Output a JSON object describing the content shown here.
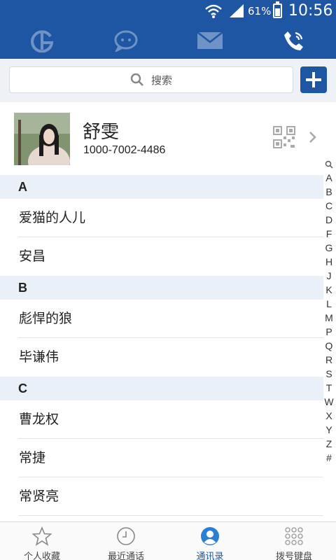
{
  "status_bar": {
    "battery_percent": "61%",
    "time": "10:56"
  },
  "top_tabs": [
    {
      "icon": "g-logo-icon",
      "active": false
    },
    {
      "icon": "chat-bubble-icon",
      "active": false
    },
    {
      "icon": "mail-icon",
      "active": false
    },
    {
      "icon": "phone-icon",
      "active": true
    }
  ],
  "search": {
    "placeholder": "搜索"
  },
  "profile": {
    "name": "舒雯",
    "number": "1000-7002-4486"
  },
  "sections": [
    {
      "letter": "A",
      "contacts": [
        "爱猫的人儿",
        "安昌"
      ]
    },
    {
      "letter": "B",
      "contacts": [
        "彪悍的狼",
        "毕谦伟"
      ]
    },
    {
      "letter": "C",
      "contacts": [
        "曹龙权",
        "常捷",
        "常贤亮"
      ]
    }
  ],
  "alpha_index": [
    "A",
    "B",
    "C",
    "D",
    "F",
    "G",
    "H",
    "J",
    "K",
    "L",
    "M",
    "P",
    "Q",
    "R",
    "S",
    "T",
    "W",
    "X",
    "Y",
    "Z",
    "#"
  ],
  "bottom_nav": [
    {
      "label": "个人收藏",
      "icon": "star-icon",
      "active": false
    },
    {
      "label": "最近通话",
      "icon": "clock-icon",
      "active": false
    },
    {
      "label": "通讯录",
      "icon": "contact-person-icon",
      "active": true
    },
    {
      "label": "拨号键盘",
      "icon": "dialpad-icon",
      "active": false
    }
  ],
  "colors": {
    "primary": "#1f56a4",
    "section_header_bg": "#eaf0f8"
  }
}
